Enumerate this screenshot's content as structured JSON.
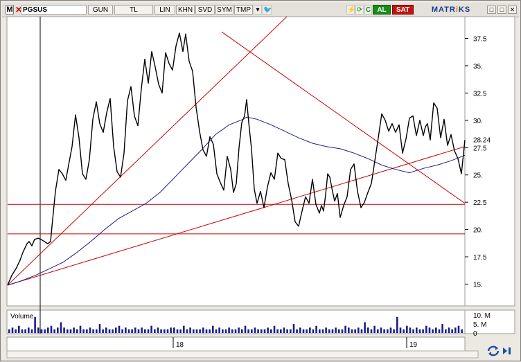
{
  "toolbar": {
    "logo": "M",
    "close": "✕",
    "symbol": "PGSUS",
    "buttons": [
      "GUN",
      "TL",
      "LIN",
      "KHN",
      "SVD",
      "SYM",
      "TMP"
    ],
    "dropdown": "▾",
    "right_icons": [
      "⚡",
      "⟳",
      "C"
    ],
    "buy": "AL",
    "sell": "SAT",
    "brand_a": "MATR",
    "brand_b": "i",
    "brand_c": "KS",
    "window": [
      "□",
      "□",
      "✕"
    ]
  },
  "volume_panel": {
    "label": "Volume",
    "ticks": [
      "10. M",
      "5. M",
      "0"
    ]
  },
  "colors": {
    "price": "#000000",
    "moving_average": "#1c1c8c",
    "trend_lines": "#cc0000",
    "grid_bg": "#ffffff"
  },
  "chart_data": {
    "type": "line",
    "symbol": "PGSUS",
    "y_ticks": [
      "37.5",
      "35.",
      "32.5",
      "30.",
      "27.5",
      "25.",
      "22.5",
      "20.",
      "17.5",
      "15."
    ],
    "ylim": [
      13,
      39.5
    ],
    "last_price_label": "28.24",
    "x_ticks": [
      "18",
      "19"
    ],
    "horizontal_levels": [
      22.3,
      19.6
    ],
    "series": [
      {
        "x": [
          0,
          6,
          12,
          18,
          22,
          28,
          31,
          35,
          39,
          44,
          48,
          53,
          58,
          62,
          64,
          69,
          74,
          79,
          84,
          88,
          93,
          98,
          103,
          108,
          113,
          118,
          123,
          128,
          133,
          138,
          143,
          148,
          153,
          158,
          163,
          168,
          173,
          178,
          183,
          188,
          193,
          198,
          203,
          208,
          213,
          218,
          223,
          228,
          233,
          238,
          243,
          248,
          253,
          257,
          262,
          267,
          272,
          277,
          282,
          287,
          292,
          297,
          302,
          307,
          312,
          317,
          322,
          326,
          330,
          334,
          338,
          342,
          345,
          348,
          352,
          356,
          360,
          365,
          370,
          375,
          380,
          385,
          390,
          395,
          400,
          405,
          410,
          415,
          420,
          425,
          430,
          435,
          440,
          445,
          450,
          453,
          456,
          459,
          462,
          465,
          468,
          472,
          476,
          480,
          485,
          490,
          495,
          500,
          505,
          510,
          515,
          520,
          525,
          530,
          535,
          540,
          545,
          550,
          555,
          560,
          565,
          570,
          575,
          580,
          585,
          590,
          595,
          600,
          603,
          606,
          610,
          615,
          620,
          625,
          630,
          635,
          640,
          645,
          650,
          655,
          660
        ],
        "values": [
          14.9,
          15.8,
          16.4,
          17.2,
          17.9,
          18.7,
          18.9,
          18.5,
          19.1,
          19.2,
          19.1,
          18.9,
          18.7,
          18.9,
          20.3,
          23.5,
          25.5,
          25.1,
          24.5,
          25.9,
          27.6,
          30.5,
          28.4,
          25.1,
          24.6,
          26.4,
          30.1,
          31.7,
          29.7,
          28.9,
          30.7,
          32.0,
          27.6,
          25.3,
          24.8,
          27.0,
          31.8,
          33.1,
          30.4,
          29.5,
          32.9,
          35.6,
          33.4,
          36.3,
          34.9,
          33.3,
          32.5,
          36.2,
          35.2,
          34.6,
          36.8,
          38.0,
          36.3,
          37.9,
          35.4,
          34.5,
          31.2,
          29.0,
          27.3,
          26.7,
          28.5,
          27.8,
          25.1,
          24.3,
          23.6,
          26.7,
          25.5,
          23.4,
          24.2,
          27.5,
          29.8,
          30.4,
          31.9,
          29.8,
          27.4,
          23.7,
          22.4,
          23.5,
          22.0,
          23.9,
          25.2,
          24.6,
          27.0,
          26.5,
          26.4,
          24.2,
          22.7,
          20.7,
          20.3,
          21.7,
          23.0,
          22.4,
          24.6,
          22.3,
          21.5,
          22.2,
          21.7,
          23.2,
          25.1,
          24.8,
          23.8,
          22.6,
          23.3,
          21.1,
          22.2,
          23.0,
          25.5,
          26.0,
          23.5,
          22.0,
          22.5,
          23.4,
          24.2,
          26.3,
          28.4,
          30.6,
          30.0,
          29.0,
          29.7,
          28.9,
          29.6,
          27.0,
          28.3,
          30.2,
          30.4,
          28.6,
          30.0,
          28.6,
          29.4,
          29.7,
          28.2,
          31.6,
          31.1,
          28.4,
          30.1,
          27.7,
          28.7,
          27.2,
          26.5,
          25.1,
          28.2
        ]
      },
      {
        "x": [
          0,
          20,
          40,
          60,
          80,
          100,
          120,
          140,
          160,
          180,
          200,
          220,
          240,
          260,
          280,
          300,
          320,
          340,
          345,
          360,
          380,
          400,
          420,
          440,
          460,
          480,
          500,
          520,
          540,
          560,
          580,
          600,
          620,
          640,
          660
        ],
        "values": [
          14.9,
          15.3,
          15.8,
          16.4,
          17.0,
          17.9,
          18.9,
          20.0,
          21.0,
          21.7,
          22.4,
          23.4,
          24.7,
          26.0,
          27.3,
          28.7,
          29.6,
          30.1,
          30.3,
          30.1,
          29.6,
          29.0,
          28.4,
          27.9,
          27.6,
          27.4,
          27.0,
          26.5,
          25.9,
          25.5,
          25.2,
          25.6,
          25.9,
          26.3,
          26.8
        ]
      }
    ],
    "trend_lines": [
      {
        "x": [
          0,
          660
        ],
        "values": [
          14.9,
          27.6
        ]
      },
      {
        "x": [
          0,
          526
        ],
        "values": [
          14.9,
          47.0
        ]
      },
      {
        "x": [
          309,
          660
        ],
        "values": [
          38.1,
          22.4
        ]
      }
    ],
    "volume": [
      2,
      3,
      2,
      4,
      2,
      2,
      3,
      2,
      9,
      3,
      2,
      2,
      3,
      4,
      2,
      3,
      6,
      3,
      2,
      2,
      3,
      2,
      4,
      2,
      2,
      3,
      2,
      2,
      5,
      2,
      3,
      2,
      2,
      3,
      4,
      2,
      3,
      2,
      2,
      3,
      2,
      3,
      2,
      2,
      4,
      2,
      3,
      2,
      2,
      2,
      3,
      3,
      2,
      2,
      4,
      2,
      3,
      2,
      2,
      2,
      3,
      2,
      2,
      4,
      2,
      3,
      2,
      2,
      3,
      2,
      2,
      3,
      2,
      4,
      2,
      2,
      3,
      2,
      2,
      2,
      3,
      2,
      4,
      2,
      2,
      3,
      2,
      2,
      5,
      2,
      3,
      2,
      2,
      3,
      2,
      4,
      2,
      2,
      3,
      2,
      2,
      3,
      2,
      2,
      4,
      3,
      2,
      2,
      3,
      2,
      6,
      3,
      2,
      4,
      2,
      3,
      2,
      2,
      3,
      2,
      9,
      3,
      2,
      4,
      3,
      2,
      3,
      2,
      2,
      4,
      3,
      2,
      3,
      2,
      5,
      2,
      3,
      2,
      3,
      4,
      2
    ]
  }
}
